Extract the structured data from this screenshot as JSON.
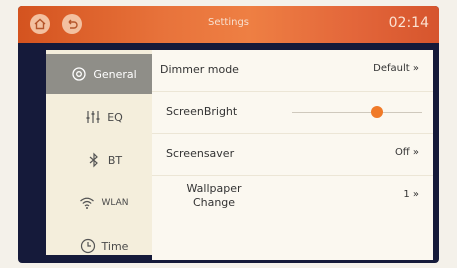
{
  "header": {
    "title": "Settings",
    "time": "02:14",
    "home_icon": "home-icon",
    "back_icon": "back-icon"
  },
  "sidebar": {
    "items": [
      {
        "label": "General",
        "icon": "gear-icon",
        "active": true
      },
      {
        "label": "EQ",
        "icon": "equalizer-icon",
        "active": false
      },
      {
        "label": "BT",
        "icon": "bluetooth-icon",
        "active": false
      },
      {
        "label": "WLAN",
        "icon": "wifi-icon",
        "active": false
      },
      {
        "label": "Time",
        "icon": "clock-icon",
        "active": false
      }
    ]
  },
  "settings": {
    "dimmer": {
      "label": "Dimmer mode",
      "value": "Default »"
    },
    "brightness": {
      "label": "ScreenBright",
      "level": 0.65
    },
    "screensaver": {
      "label": "Screensaver",
      "value": "Off »"
    },
    "wallpaper": {
      "label": "Wallpaper Change",
      "value": "1 »"
    }
  },
  "colors": {
    "accent": "#f07a28",
    "header_gradient_start": "#d4531f",
    "sidebar_active": "#8f8e88"
  }
}
